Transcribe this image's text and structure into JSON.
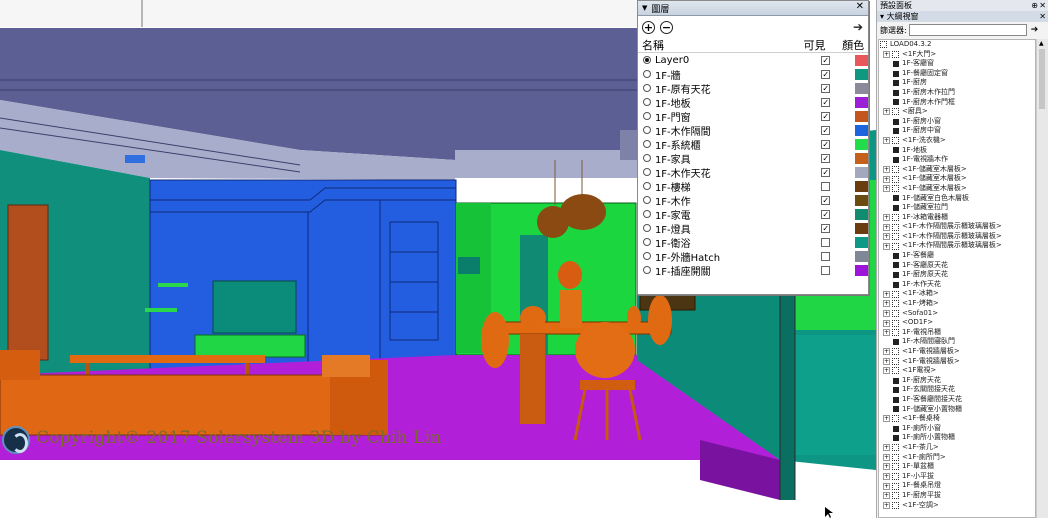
{
  "viewport": {
    "copyright": "Copyright© 2017 Solarsystem 3D by Chih Lin"
  },
  "layers_panel": {
    "title": "圖層",
    "add_icon": "add-layer-icon",
    "remove_icon": "remove-layer-icon",
    "details_icon": "details-arrow-icon",
    "col_name": "名稱",
    "col_visible": "可見",
    "col_color": "顏色",
    "layers": [
      {
        "name": "Layer0",
        "active": true,
        "visible": true,
        "color": "#e8585a"
      },
      {
        "name": "1F-牆",
        "active": false,
        "visible": true,
        "color": "#0e9880"
      },
      {
        "name": "1F-原有天花",
        "active": false,
        "visible": true,
        "color": "#8a8a9a"
      },
      {
        "name": "1F-地板",
        "active": false,
        "visible": true,
        "color": "#9b1fd6"
      },
      {
        "name": "1F-門窗",
        "active": false,
        "visible": true,
        "color": "#c3561e"
      },
      {
        "name": "1F-木作隔間",
        "active": false,
        "visible": true,
        "color": "#1d64df"
      },
      {
        "name": "1F-系統櫃",
        "active": false,
        "visible": true,
        "color": "#22dc4a"
      },
      {
        "name": "1F-家具",
        "active": false,
        "visible": true,
        "color": "#c4601c"
      },
      {
        "name": "1F-木作天花",
        "active": false,
        "visible": true,
        "color": "#a4a8be"
      },
      {
        "name": "1F-樓梯",
        "active": false,
        "visible": false,
        "color": "#6b3c10"
      },
      {
        "name": "1F-木作",
        "active": false,
        "visible": true,
        "color": "#6b4c10"
      },
      {
        "name": "1F-家電",
        "active": false,
        "visible": true,
        "color": "#128c70"
      },
      {
        "name": "1F-燈具",
        "active": false,
        "visible": true,
        "color": "#6b3c10"
      },
      {
        "name": "1F-衛浴",
        "active": false,
        "visible": false,
        "color": "#0e9886"
      },
      {
        "name": "1F-外牆Hatch",
        "active": false,
        "visible": false,
        "color": "#808898"
      },
      {
        "name": "1F-插座開關",
        "active": false,
        "visible": false,
        "color": "#9b16d8"
      }
    ]
  },
  "tray": {
    "title": "預設面板",
    "subtitle": "大綱視窗",
    "filter_label": "篩選器:",
    "filter_value": "",
    "outline": [
      {
        "label": "LOAD04.3.2",
        "expand": "",
        "kind": "root",
        "indent": 0
      },
      {
        "label": "<1F大門>",
        "expand": "+",
        "kind": "group",
        "indent": 0
      },
      {
        "label": "1F-客廳窗",
        "expand": "",
        "kind": "comp",
        "indent": 1
      },
      {
        "label": "1F-餐廳固定窗",
        "expand": "",
        "kind": "comp",
        "indent": 1
      },
      {
        "label": "1F-廚房",
        "expand": "",
        "kind": "comp",
        "indent": 1
      },
      {
        "label": "1F-廚房木作拉門",
        "expand": "",
        "kind": "comp",
        "indent": 1
      },
      {
        "label": "1F-廚房木作門框",
        "expand": "",
        "kind": "comp",
        "indent": 1
      },
      {
        "label": "<廚具>",
        "expand": "+",
        "kind": "group",
        "indent": 0
      },
      {
        "label": "1F-廚房小窗",
        "expand": "",
        "kind": "comp",
        "indent": 1
      },
      {
        "label": "1F-廚房中窗",
        "expand": "",
        "kind": "comp",
        "indent": 1
      },
      {
        "label": "<1F-洗衣機>",
        "expand": "+",
        "kind": "group",
        "indent": 0
      },
      {
        "label": "1F-地板",
        "expand": "",
        "kind": "comp",
        "indent": 1
      },
      {
        "label": "1F-電視牆木作",
        "expand": "",
        "kind": "comp",
        "indent": 1
      },
      {
        "label": "<1F-儲藏室木層板>",
        "expand": "+",
        "kind": "group",
        "indent": 0
      },
      {
        "label": "<1F-儲藏室木層板>",
        "expand": "+",
        "kind": "group",
        "indent": 0
      },
      {
        "label": "<1F-儲藏室木層板>",
        "expand": "+",
        "kind": "group",
        "indent": 0
      },
      {
        "label": "1F-儲藏室白色木層板",
        "expand": "",
        "kind": "comp",
        "indent": 1
      },
      {
        "label": "1F-儲藏室拉門",
        "expand": "",
        "kind": "comp",
        "indent": 1
      },
      {
        "label": "1F-冰箱電器櫃",
        "expand": "+",
        "kind": "group",
        "indent": 0
      },
      {
        "label": "<1F-木作隔間展示櫃玻璃層板>",
        "expand": "+",
        "kind": "group",
        "indent": 0
      },
      {
        "label": "<1F-木作隔間展示櫃玻璃層板>",
        "expand": "+",
        "kind": "group",
        "indent": 0
      },
      {
        "label": "<1F-木作隔間展示櫃玻璃層板>",
        "expand": "+",
        "kind": "group",
        "indent": 0
      },
      {
        "label": "1F-客餐廳",
        "expand": "",
        "kind": "comp",
        "indent": 1
      },
      {
        "label": "1F-客廳原天花",
        "expand": "",
        "kind": "comp",
        "indent": 1
      },
      {
        "label": "1F-廚房原天花",
        "expand": "",
        "kind": "comp",
        "indent": 1
      },
      {
        "label": "1F-木作天花",
        "expand": "",
        "kind": "comp",
        "indent": 1
      },
      {
        "label": "<1F-冰箱>",
        "expand": "+",
        "kind": "group",
        "indent": 0
      },
      {
        "label": "<1F-烤箱>",
        "expand": "+",
        "kind": "group",
        "indent": 0
      },
      {
        "label": "<Sofa01>",
        "expand": "+",
        "kind": "group",
        "indent": 0
      },
      {
        "label": "<OD1F>",
        "expand": "+",
        "kind": "group",
        "indent": 0
      },
      {
        "label": "1F-電視吊櫃",
        "expand": "+",
        "kind": "group",
        "indent": 0
      },
      {
        "label": "1F-木隔間寢臥門",
        "expand": "",
        "kind": "comp",
        "indent": 1
      },
      {
        "label": "<1F-電視牆層板>",
        "expand": "+",
        "kind": "group",
        "indent": 0
      },
      {
        "label": "<1F-電視牆層板>",
        "expand": "+",
        "kind": "group",
        "indent": 0
      },
      {
        "label": "<1F電視>",
        "expand": "+",
        "kind": "group",
        "indent": 0
      },
      {
        "label": "1F-廚房天花",
        "expand": "",
        "kind": "comp",
        "indent": 1
      },
      {
        "label": "1F-玄關間接天花",
        "expand": "",
        "kind": "comp",
        "indent": 1
      },
      {
        "label": "1F-客餐廳間接天花",
        "expand": "",
        "kind": "comp",
        "indent": 1
      },
      {
        "label": "1F-儲藏室小置物櫃",
        "expand": "",
        "kind": "comp",
        "indent": 1
      },
      {
        "label": "<1F-餐桌椅",
        "expand": "+",
        "kind": "group",
        "indent": 0
      },
      {
        "label": "1F-廁所小窗",
        "expand": "",
        "kind": "comp",
        "indent": 1
      },
      {
        "label": "1F-廁所小置物櫃",
        "expand": "",
        "kind": "comp",
        "indent": 1
      },
      {
        "label": "<1F-茶几>",
        "expand": "+",
        "kind": "group",
        "indent": 0
      },
      {
        "label": "<1F-廁所門>",
        "expand": "+",
        "kind": "group",
        "indent": 0
      },
      {
        "label": "1F-單盆櫃",
        "expand": "+",
        "kind": "group",
        "indent": 0
      },
      {
        "label": "1F-小平拔",
        "expand": "+",
        "kind": "group",
        "indent": 0
      },
      {
        "label": "1F-餐桌吊燈",
        "expand": "+",
        "kind": "group",
        "indent": 0
      },
      {
        "label": "1F-廚房平拔",
        "expand": "+",
        "kind": "group",
        "indent": 0
      },
      {
        "label": "<1F-空調>",
        "expand": "+",
        "kind": "group",
        "indent": 0
      }
    ]
  }
}
